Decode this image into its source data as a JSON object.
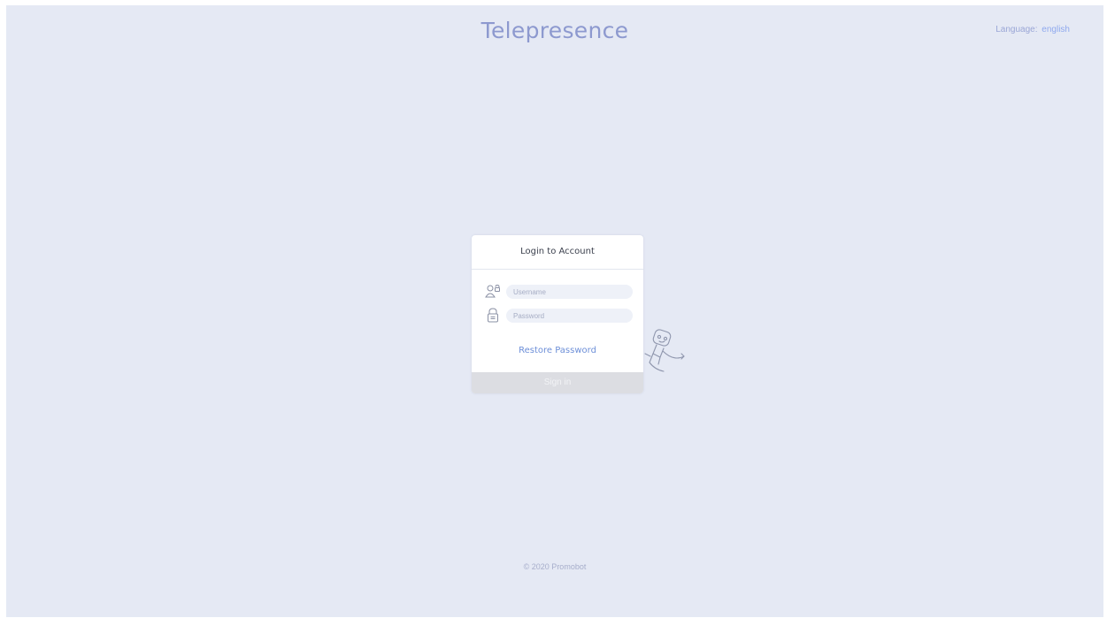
{
  "header": {
    "title": "Telepresence",
    "language_label": "Language:",
    "language_value": "english"
  },
  "login": {
    "title": "Login to Account",
    "username_placeholder": "Username",
    "password_placeholder": "Password",
    "restore_link": "Restore Password",
    "signin_button": "Sign in"
  },
  "footer": {
    "copyright": "© 2020 Promobot"
  },
  "colors": {
    "background": "#e5e9f4",
    "title": "#8d99cf",
    "link": "#6d8fd8",
    "signin_disabled": "#dcdde2"
  },
  "icons": [
    "user-icon",
    "lock-icon",
    "robot-mascot-icon"
  ]
}
